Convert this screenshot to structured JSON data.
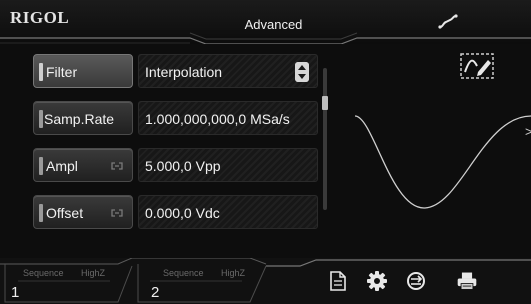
{
  "header": {
    "brand": "RIGOL",
    "title": "Advanced"
  },
  "params": [
    {
      "label": "Filter",
      "value": "Interpolation",
      "has_spinner": true,
      "locked_icon": false
    },
    {
      "label": "Samp.Rate",
      "value": "1.000,000,000,0 MSa/s",
      "has_spinner": false,
      "locked_icon": false
    },
    {
      "label": "Ampl",
      "value": "5.000,0 Vpp",
      "has_spinner": false,
      "locked_icon": true
    },
    {
      "label": "Offset",
      "value": "0.000,0 Vdc",
      "has_spinner": false,
      "locked_icon": true
    }
  ],
  "channels": [
    {
      "number": "1",
      "mode": "Sequence",
      "impedance": "HighZ"
    },
    {
      "number": "2",
      "mode": "Sequence",
      "impedance": "HighZ"
    }
  ],
  "icons": {
    "link": "link-icon",
    "edit": "edit-waveform-icon",
    "file": "file-icon",
    "settings": "gear-icon",
    "sync": "sync-icon",
    "print": "printer-icon"
  }
}
